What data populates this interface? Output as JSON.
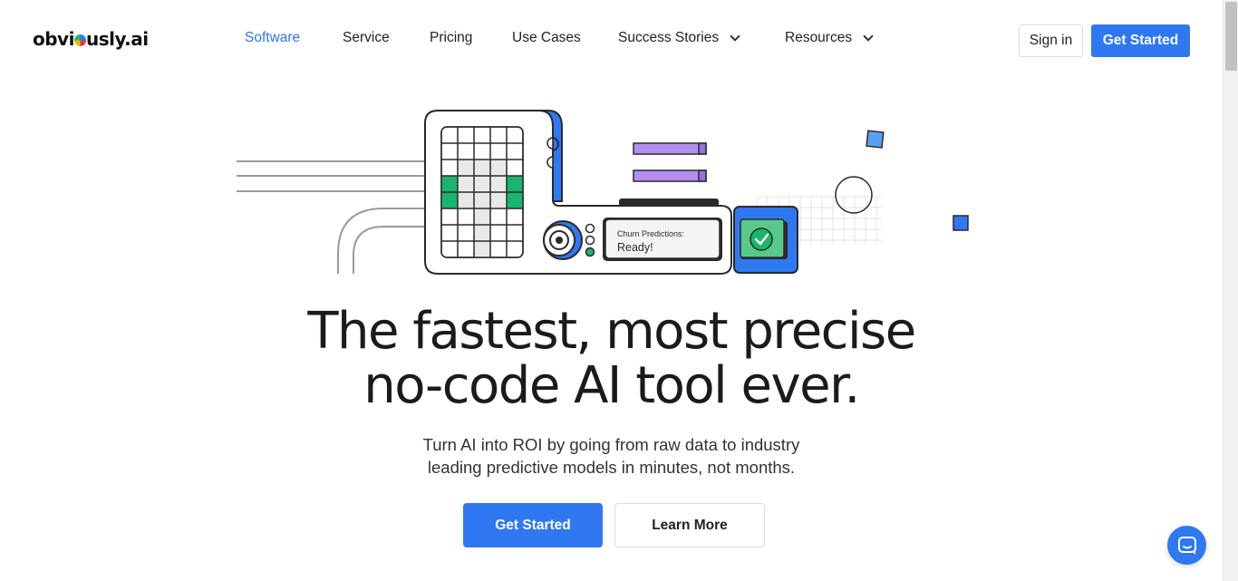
{
  "brand": {
    "logo_text_left": "obvi",
    "logo_text_right": "usly.ai",
    "accent_color": "#2f78f2"
  },
  "nav": {
    "items": [
      {
        "label": "Software",
        "active": true,
        "dropdown": false
      },
      {
        "label": "Service",
        "active": false,
        "dropdown": false
      },
      {
        "label": "Pricing",
        "active": false,
        "dropdown": false
      },
      {
        "label": "Use Cases",
        "active": false,
        "dropdown": false
      },
      {
        "label": "Success Stories",
        "active": false,
        "dropdown": true
      },
      {
        "label": "Resources",
        "active": false,
        "dropdown": true
      }
    ]
  },
  "header": {
    "signin_label": "Sign in",
    "getstarted_label": "Get Started"
  },
  "illustration": {
    "status_title": "Churn Predictions:",
    "status_value": "Ready!"
  },
  "hero": {
    "headline_line1": "The fastest, most precise",
    "headline_line2": "no-code AI tool ever.",
    "subtitle_line1": "Turn AI into ROI by going from raw data to industry",
    "subtitle_line2": "leading predictive models in minutes, not months.",
    "cta_primary": "Get Started",
    "cta_secondary": "Learn More"
  },
  "icons": {
    "chat": "chat-bubble-icon",
    "chevron": "chevron-down-icon",
    "check": "check-icon"
  }
}
